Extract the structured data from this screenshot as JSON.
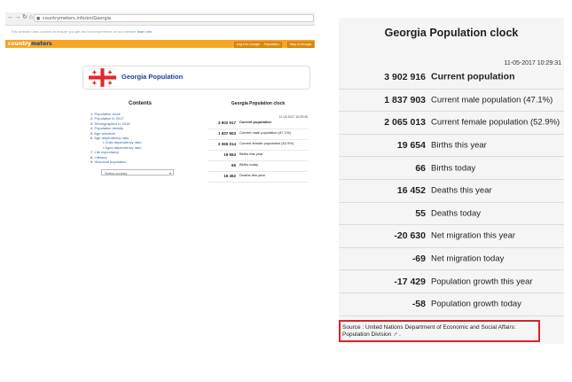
{
  "mini": {
    "url": "countrymeters.info/en/Georgia",
    "cookie_notice": "This website uses cookies to ensure you get the best experience on our website",
    "cookie_link": "learn info",
    "logo_part1": "country",
    "logo_part2": "meters",
    "header_buttons": [
      "Log in to Google",
      "Population",
      "Map of Georgia"
    ],
    "page_title": "Georgia Population",
    "contents_heading": "Contents",
    "contents": [
      {
        "num": "1.",
        "label": "Population clock",
        "sub": false
      },
      {
        "num": "2.",
        "label": "Population in 2017",
        "sub": false
      },
      {
        "num": "3.",
        "label": "Demographics in 2016",
        "sub": false
      },
      {
        "num": "4.",
        "label": "Population density",
        "sub": false
      },
      {
        "num": "5.",
        "label": "Age structure",
        "sub": false
      },
      {
        "num": "6.",
        "label": "Age dependency ratio",
        "sub": false
      },
      {
        "num": "•",
        "label": "Child dependency ratio",
        "sub": true
      },
      {
        "num": "•",
        "label": "Aged dependency ratio",
        "sub": true
      },
      {
        "num": "7.",
        "label": "Life expectancy",
        "sub": false
      },
      {
        "num": "8.",
        "label": "Literacy",
        "sub": false
      },
      {
        "num": "9.",
        "label": "Historical population",
        "sub": false
      }
    ],
    "select_placeholder": "Select country",
    "clock_heading": "Georgia Population clock",
    "clock_datetime": "11-05-2017 10:29:26",
    "rows": [
      {
        "value": "3 902 917",
        "label": "Current population"
      },
      {
        "value": "1 837 903",
        "label": "Current male population (47.1%)"
      },
      {
        "value": "2 065 014",
        "label": "Current female population (52.9%)"
      },
      {
        "value": "19 653",
        "label": "Births this year"
      },
      {
        "value": "65",
        "label": "Births today"
      },
      {
        "value": "16 452",
        "label": "Deaths this year"
      }
    ]
  },
  "panel": {
    "title": "Georgia Population clock",
    "datetime": "11-05-2017 10:29:31",
    "rows": [
      {
        "value": "3 902 916",
        "label": "Current population"
      },
      {
        "value": "1 837 903",
        "label": "Current male population (47.1%)"
      },
      {
        "value": "2 065 013",
        "label": "Current female population (52.9%)"
      },
      {
        "value": "19 654",
        "label": "Births this year"
      },
      {
        "value": "66",
        "label": "Births today"
      },
      {
        "value": "16 452",
        "label": "Deaths this year"
      },
      {
        "value": "55",
        "label": "Deaths today"
      },
      {
        "value": "-20 630",
        "label": "Net migration this year"
      },
      {
        "value": "-69",
        "label": "Net migration today"
      },
      {
        "value": "-17 429",
        "label": "Population growth this year"
      },
      {
        "value": "-58",
        "label": "Population growth today"
      }
    ],
    "source_text": "Source : United Nations Department of Economic and Social Affairs: Population Division",
    "source_end": "."
  },
  "colors": {
    "header_orange": "#f5a623",
    "title_blue": "#1a3e9c",
    "link_blue": "#3262b5",
    "highlight_red": "#d8232a",
    "flag_red": "#e3262d"
  },
  "icons": [
    "back-icon",
    "forward-icon",
    "reload-icon",
    "home-icon",
    "lock-icon",
    "georgia-flag-icon",
    "external-link-icon",
    "dropdown-arrow-icon"
  ]
}
